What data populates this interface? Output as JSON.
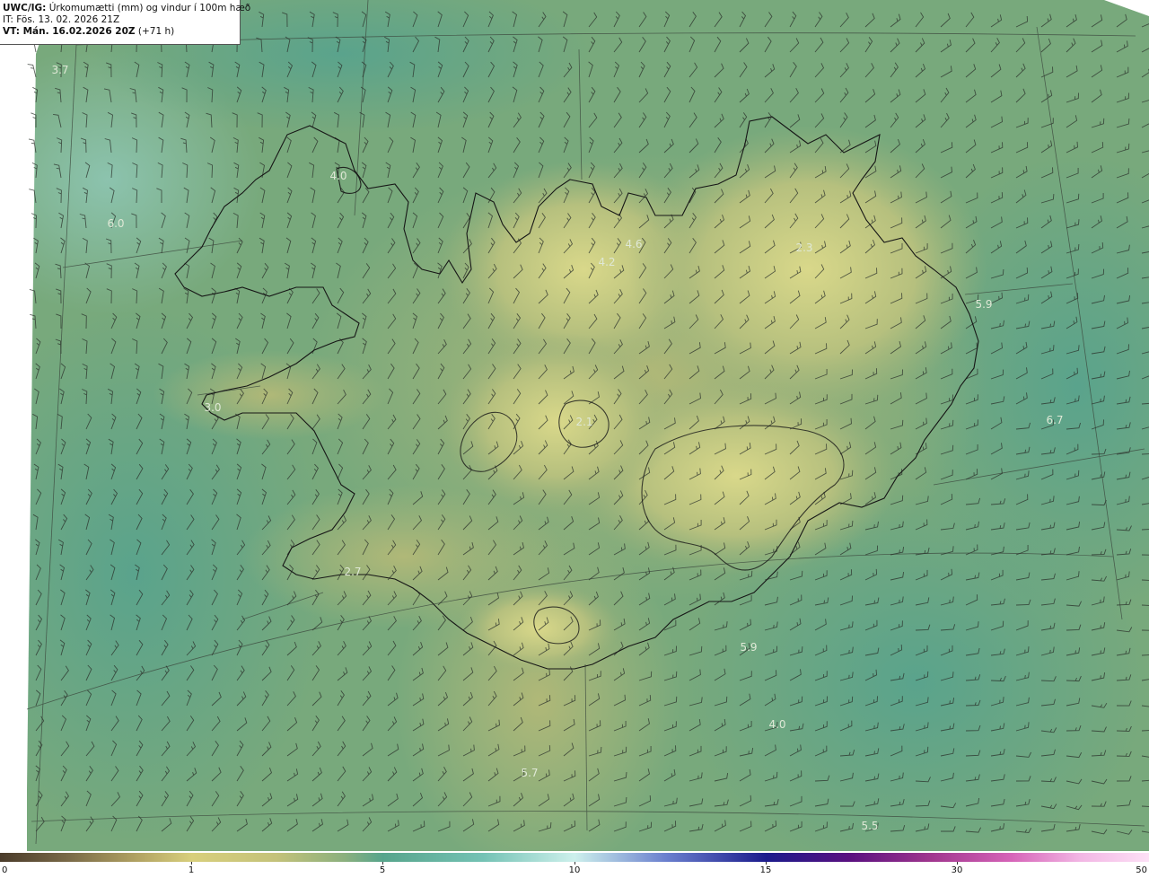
{
  "header": {
    "model": "UWC/IG:",
    "title": "Úrkomumætti (mm) og vindur í 100m hæð",
    "init_time": "IT: Fös. 13. 02. 2026 21Z",
    "valid_prefix": "VT: Mán. 16.02.2026 20Z",
    "valid_suffix": "(+71 h)"
  },
  "map_values": [
    {
      "label": "3.7"
    },
    {
      "label": "4.0"
    },
    {
      "label": "6.0"
    },
    {
      "label": "4.6"
    },
    {
      "label": "4.2"
    },
    {
      "label": "2.3"
    },
    {
      "label": "5.9"
    },
    {
      "label": "3.0"
    },
    {
      "label": "2.1"
    },
    {
      "label": "6.7"
    },
    {
      "label": "2.7"
    },
    {
      "label": "5.9"
    },
    {
      "label": "4.0"
    },
    {
      "label": "5.7"
    },
    {
      "label": "5.5"
    }
  ],
  "legend": {
    "ticks": [
      "0",
      "1",
      "5",
      "10",
      "15",
      "30",
      "50"
    ]
  },
  "colors": {
    "sea_low": "#4f9d83",
    "sea_mid": "#6aa780",
    "land_high": "#d6d88a",
    "coastline": "#1a1a1a"
  }
}
